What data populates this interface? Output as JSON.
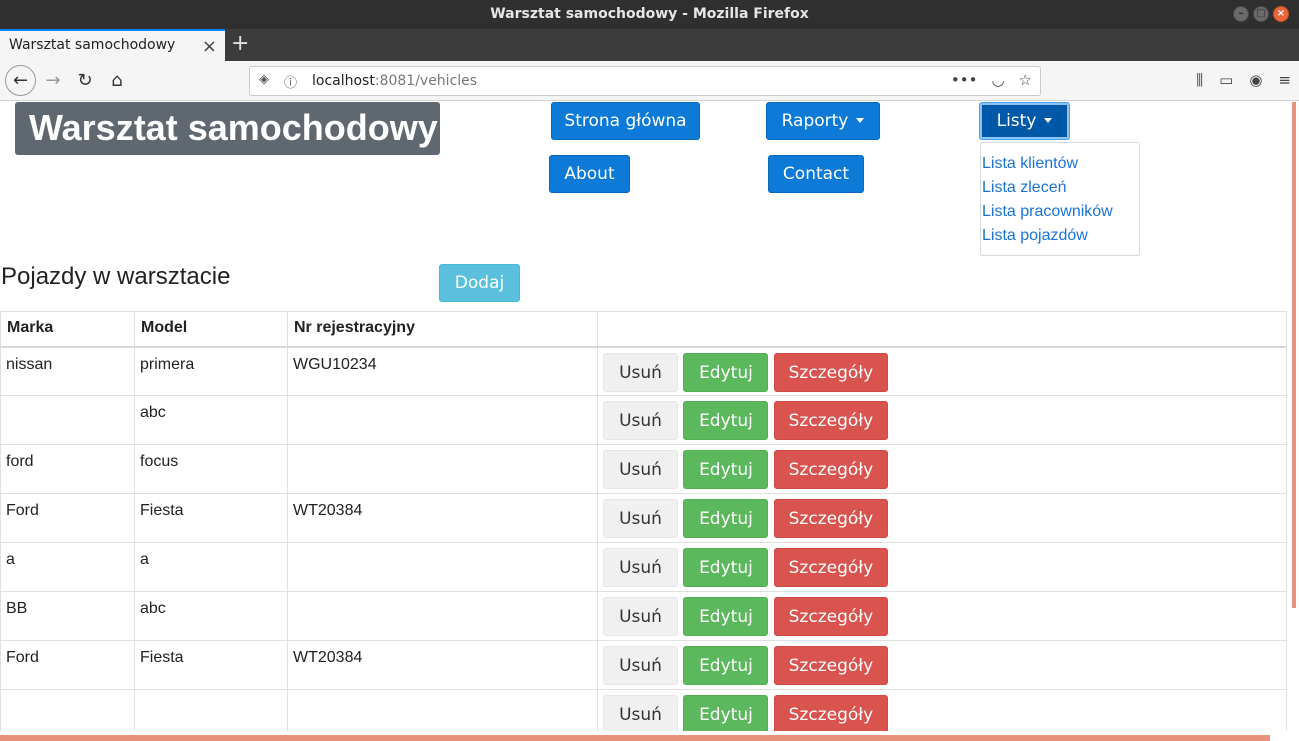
{
  "window": {
    "title": "Warsztat samochodowy - Mozilla Firefox"
  },
  "tab": {
    "title": "Warsztat samochodowy"
  },
  "urlbar": {
    "host": "localhost",
    "rest": ":8081/vehicles"
  },
  "brand": "Warsztat samochodowy",
  "nav": {
    "home": "Strona główna",
    "reports": "Raporty",
    "lists": "Listy",
    "about": "About",
    "contact": "Contact"
  },
  "dropdown": [
    "Lista klientów",
    "Lista zleceń",
    "Lista pracowników",
    "Lista pojazdów"
  ],
  "heading": "Pojazdy w warsztacie",
  "add_label": "Dodaj",
  "table": {
    "headers": [
      "Marka",
      "Model",
      "Nr rejestracyjny",
      ""
    ],
    "rows": [
      {
        "marka": "nissan",
        "model": "primera",
        "nr": "WGU10234"
      },
      {
        "marka": "",
        "model": "abc",
        "nr": ""
      },
      {
        "marka": "ford",
        "model": "focus",
        "nr": ""
      },
      {
        "marka": "Ford",
        "model": "Fiesta",
        "nr": "WT20384"
      },
      {
        "marka": "a",
        "model": "a",
        "nr": ""
      },
      {
        "marka": "BB",
        "model": "abc",
        "nr": ""
      },
      {
        "marka": "Ford",
        "model": "Fiesta",
        "nr": "WT20384"
      },
      {
        "marka": "",
        "model": "",
        "nr": ""
      }
    ],
    "actions": {
      "delete": "Usuń",
      "edit": "Edytuj",
      "details": "Szczegóły"
    }
  },
  "colors": {
    "primary": "#0c7ad6",
    "success": "#5cb85c",
    "danger": "#d9534f",
    "info": "#5bc0de",
    "brand_bg": "#5f6870"
  }
}
